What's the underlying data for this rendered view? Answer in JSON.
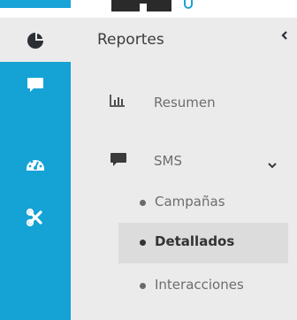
{
  "header": {
    "title": "Reportes",
    "icon": "pie-chart-icon",
    "collapse_icon": "chevron-left-icon"
  },
  "rail": {
    "items": [
      {
        "icon": "chat-bubble-icon"
      },
      {
        "icon": "dashboard-gauge-icon"
      },
      {
        "icon": "tools-icon"
      }
    ]
  },
  "menu": {
    "resumen": {
      "label": "Resumen",
      "icon": "bar-chart-icon"
    },
    "sms": {
      "label": "SMS",
      "icon": "chat-bubble-icon",
      "expand_icon": "chevron-down-icon",
      "subitems": [
        {
          "label": "Campañas"
        },
        {
          "label": "Detallados",
          "active": true
        },
        {
          "label": "Interacciones"
        }
      ]
    }
  },
  "colors": {
    "rail": "#15a2d5",
    "panel": "#ebebeb",
    "active_bg": "#dcdcdc",
    "text_primary": "#333333",
    "text_muted": "#6d6d6d"
  }
}
